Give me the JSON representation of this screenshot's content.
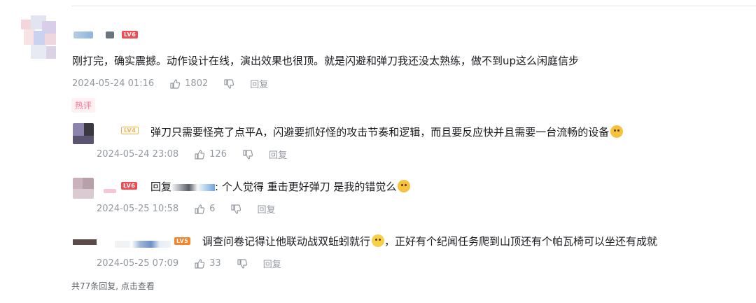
{
  "main_comment": {
    "level": "LV6",
    "text": "刚打完，确实震撼。动作设计在线，演出效果也很顶。就是闪避和弹刀我还没太熟练，做不到up这么闲庭信步",
    "date": "2024-05-24 01:16",
    "likes": "1802",
    "reply_label": "回复",
    "hot_tag": "热评"
  },
  "replies": [
    {
      "level": "LV4",
      "text": "弹刀只需要怪亮了点平A，闪避要抓好怪的攻击节奏和逻辑，而且要反应快并且需要一台流畅的设备",
      "date": "2024-05-24 23:08",
      "likes": "126",
      "reply_label": "回复"
    },
    {
      "level": "LV6",
      "reply_prefix": "回复",
      "text": ": 个人觉得 重击更好弹刀 是我的错觉么",
      "date": "2024-05-25 10:58",
      "likes": "6",
      "reply_label": "回复"
    },
    {
      "level": "LV5",
      "text_a": "调查问卷记得让他联动战双蚯蚓就行",
      "text_b": "，正好有个纪闻任务爬到山顶还有个帕瓦椅可以坐还有成就",
      "date": "2024-05-25 07:09",
      "likes": "33",
      "reply_label": "回复"
    }
  ],
  "more_replies": "共77条回复, 点击查看",
  "colors": {
    "hot_pink": "#fb7299",
    "meta_gray": "#9499a0",
    "lv6": "#ef4b55",
    "lv5": "#f5822c"
  }
}
